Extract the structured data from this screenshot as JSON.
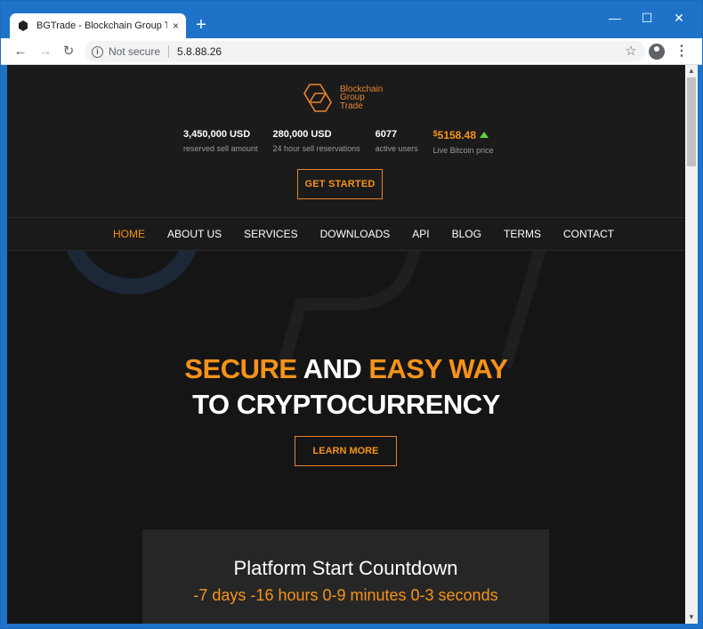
{
  "browser": {
    "tab_title": "BGTrade - Blockchain Group Trad",
    "tab_close": "×",
    "new_tab": "+",
    "security": "Not secure",
    "url": "5.8.88.26",
    "controls": {
      "minimize": "—",
      "maximize": "☐",
      "close": "✕"
    },
    "nav": {
      "back": "←",
      "forward": "→",
      "reload": "↻"
    },
    "star": "☆",
    "menu": "⋮"
  },
  "site": {
    "logo_text": [
      "Blockchain",
      "Group",
      "Trade"
    ],
    "stats": [
      {
        "value": "3,450,000 USD",
        "label": "reserved sell amount"
      },
      {
        "value": "280,000 USD",
        "label": "24 hour sell reservations"
      },
      {
        "value": "6077",
        "label": "active users"
      }
    ],
    "bitcoin": {
      "symbol": "$",
      "price": "5158.48",
      "label": "Live Bitcoin price"
    },
    "get_started": "GET STARTED",
    "nav": [
      "HOME",
      "ABOUT US",
      "SERVICES",
      "DOWNLOADS",
      "API",
      "BLOG",
      "TERMS",
      "CONTACT"
    ],
    "active_nav": "HOME",
    "headline_line1": {
      "part1": "SECURE",
      "part2": "AND",
      "part3": "EASY WAY"
    },
    "headline_line2": "TO CRYPTOCURRENCY",
    "learn_more": "LEARN MORE",
    "countdown_title": "Platform Start Countdown",
    "countdown_value": "-7 days -16 hours 0-9 minutes 0-3 seconds"
  },
  "colors": {
    "accent": "#f7931a",
    "chrome": "#1e73c8",
    "bg": "#141414",
    "arrow_up": "#5fd33a"
  }
}
